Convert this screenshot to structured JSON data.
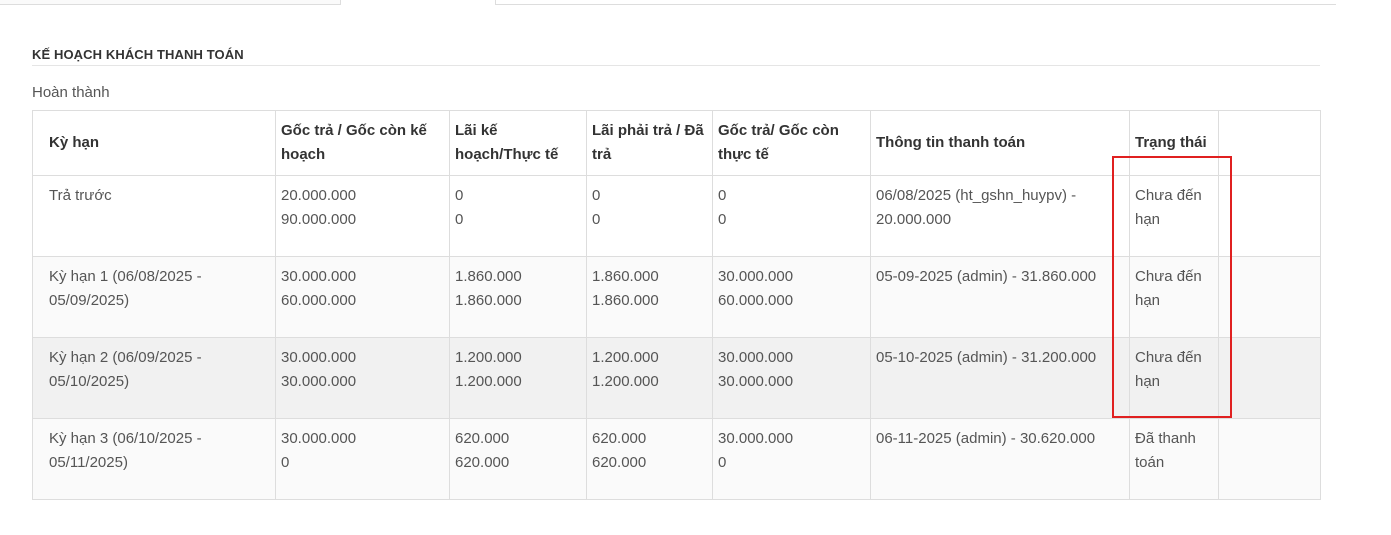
{
  "section": {
    "title": "KẾ HOẠCH KHÁCH THANH TOÁN",
    "status": "Hoàn thành"
  },
  "table": {
    "headers": [
      "Kỳ hạn",
      "Gốc trả / Gốc còn kế hoạch",
      "Lãi kế hoạch/Thực tế",
      "Lãi phải trả / Đã trả",
      "Gốc trả/ Gốc còn thực tế",
      "Thông tin thanh toán",
      "Trạng thái",
      ""
    ],
    "rows": [
      {
        "term": "Trả trước",
        "principal_plan": [
          "20.000.000",
          "90.000.000"
        ],
        "interest_plan": [
          "0",
          "0"
        ],
        "interest_due": [
          "0",
          "0"
        ],
        "principal_actual": [
          "0",
          "0"
        ],
        "payment_info": "06/08/2025 (ht_gshn_huypv) - 20.000.000",
        "status": "Chưa đến hạn"
      },
      {
        "term": "Kỳ hạn 1 (06/08/2025 - 05/09/2025)",
        "principal_plan": [
          "30.000.000",
          "60.000.000"
        ],
        "interest_plan": [
          "1.860.000",
          "1.860.000"
        ],
        "interest_due": [
          "1.860.000",
          "1.860.000"
        ],
        "principal_actual": [
          "30.000.000",
          "60.000.000"
        ],
        "payment_info": "05-09-2025 (admin) - 31.860.000",
        "status": "Chưa đến hạn"
      },
      {
        "term": "Kỳ hạn 2 (06/09/2025 - 05/10/2025)",
        "principal_plan": [
          "30.000.000",
          "30.000.000"
        ],
        "interest_plan": [
          "1.200.000",
          "1.200.000"
        ],
        "interest_due": [
          "1.200.000",
          "1.200.000"
        ],
        "principal_actual": [
          "30.000.000",
          "30.000.000"
        ],
        "payment_info": "05-10-2025 (admin) - 31.200.000",
        "status": "Chưa đến hạn"
      },
      {
        "term": "Kỳ hạn 3 (06/10/2025 - 05/11/2025)",
        "principal_plan": [
          "30.000.000",
          "0"
        ],
        "interest_plan": [
          "620.000",
          "620.000"
        ],
        "interest_due": [
          "620.000",
          "620.000"
        ],
        "principal_actual": [
          "30.000.000",
          "0"
        ],
        "payment_info": "06-11-2025 (admin) - 30.620.000",
        "status": "Đã thanh toán"
      }
    ]
  },
  "colors": {
    "highlight": "#e02020",
    "border": "#dddddd",
    "row_hover": "#f1f1f1",
    "row_alt": "#fafafa"
  }
}
